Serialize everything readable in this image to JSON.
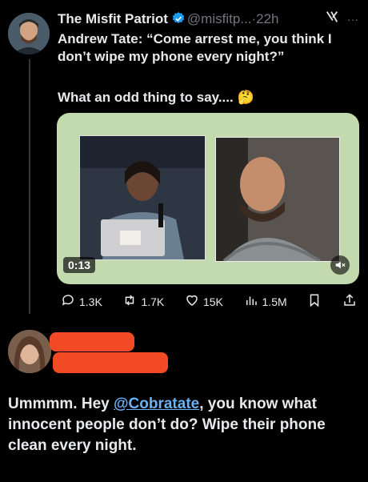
{
  "tweet": {
    "author_name": "The Misfit Patriot",
    "handle": "@misfitp...",
    "separator": "·",
    "time": "22h",
    "more": "···",
    "text_line1": "Andrew Tate: “Come arrest me, you think I don’t wipe my phone every night?”",
    "text_line2": "What an odd thing to say.... 🤔",
    "video_time": "0:13",
    "stats": {
      "replies": "1.3K",
      "reposts": "1.7K",
      "likes": "15K",
      "views": "1.5M"
    }
  },
  "reply": {
    "text_before": "Ummmm. Hey ",
    "mention": "@Cobratate",
    "text_after": ", you know what innocent people don’t do? Wipe their phone clean every night."
  },
  "colors": {
    "background": "#000000",
    "verified": "#1d9bf0",
    "redaction": "#f24a24",
    "media_bg": "#c3d9ae",
    "mention": "#6ab0f3"
  },
  "icons": [
    "verified-icon",
    "grok-icon",
    "more-icon",
    "reply-icon",
    "repost-icon",
    "like-icon",
    "views-icon",
    "bookmark-icon",
    "share-icon",
    "mute-icon"
  ]
}
